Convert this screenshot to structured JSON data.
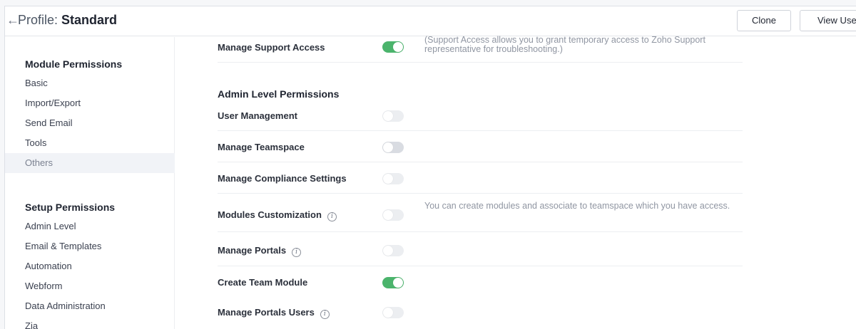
{
  "header": {
    "back_glyph": "←",
    "title_prefix": "Profile: ",
    "title_name": "Standard",
    "clone_label": "Clone",
    "view_users_label": "View User"
  },
  "sidebar": {
    "module_heading": "Module Permissions",
    "module_items": [
      "Basic",
      "Import/Export",
      "Send Email",
      "Tools",
      "Others"
    ],
    "active_item": "Others",
    "setup_heading": "Setup Permissions",
    "setup_items": [
      "Admin Level",
      "Email & Templates",
      "Automation",
      "Webform",
      "Data Administration",
      "Zia"
    ]
  },
  "main": {
    "top_row": {
      "label": "Manage Support Access",
      "enabled": true,
      "description": "(Support Access allows you to grant temporary access to Zoho Support representative for troubleshooting.)"
    },
    "section_title": "Admin Level Permissions",
    "rows": [
      {
        "label": "User Management",
        "enabled": false,
        "info": false,
        "description": ""
      },
      {
        "label": "Manage Teamspace",
        "enabled": false,
        "info": false,
        "description": ""
      },
      {
        "label": "Manage Compliance Settings",
        "enabled": false,
        "info": false,
        "description": ""
      },
      {
        "label": "Modules Customization",
        "enabled": false,
        "info": true,
        "description": "You can create modules and associate to teamspace which you have access."
      },
      {
        "label": "Manage Portals",
        "enabled": false,
        "info": true,
        "description": ""
      },
      {
        "label": "Create Team Module",
        "enabled": true,
        "info": false,
        "description": ""
      },
      {
        "label": "Manage Portals Users",
        "enabled": false,
        "info": true,
        "description": ""
      }
    ],
    "info_glyph": "i"
  },
  "colors": {
    "toggle_on": "#4bb46c",
    "toggle_off": "#eceef1",
    "active_sidebar_bg": "#f1f3f7"
  }
}
